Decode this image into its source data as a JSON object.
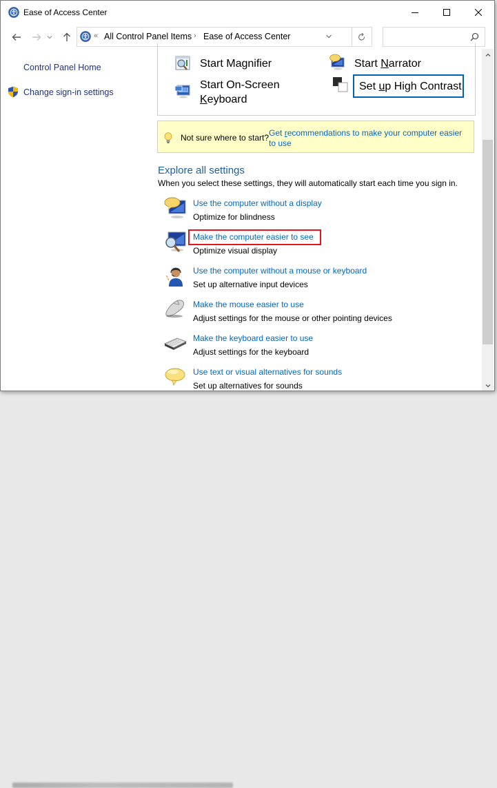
{
  "window": {
    "title": "Ease of Access Center",
    "controls": {
      "minimize": "minimize",
      "maximize": "maximize",
      "close": "close"
    }
  },
  "nav": {
    "back": "Back",
    "forward": "Forward",
    "recent": "Recent locations",
    "up": "Up",
    "overflow": "«",
    "breadcrumb": [
      "All Control Panel Items",
      "Ease of Access Center"
    ],
    "separator": "›",
    "search_placeholder": "",
    "search_value": ""
  },
  "sidebar": {
    "items": [
      {
        "label": "Control Panel Home",
        "icon": null
      },
      {
        "label": "Change sign-in settings",
        "icon": "shield-icon"
      }
    ]
  },
  "quick_access": {
    "items": [
      {
        "label": "Start Magnifier",
        "icon": "magnifier-icon"
      },
      {
        "label_pre": "Start ",
        "label_u": "N",
        "label_post": "arrator",
        "icon": "narrator-icon"
      },
      {
        "label_line1": "Start On-Screen",
        "label_u": "K",
        "label_post": "eyboard",
        "icon": "on-screen-keyboard-icon"
      },
      {
        "label_pre": "Set ",
        "label_u": "u",
        "label_post": "p High Contrast",
        "icon": "high-contrast-icon",
        "focused": true
      }
    ]
  },
  "tip": {
    "text": "Not sure where to start?",
    "link_pre": "Get ",
    "link_u": "r",
    "link_post": "ecommendations to make your computer easier to use"
  },
  "explore": {
    "title": "Explore all settings",
    "subtitle": "When you select these settings, they will automatically start each time you sign in.",
    "items": [
      {
        "link": "Use the computer without a display",
        "desc": "Optimize for blindness",
        "icon": "monitor-speech-icon"
      },
      {
        "link": "Make the computer easier to see",
        "desc": "Optimize visual display",
        "icon": "monitor-magnifier-icon",
        "highlighted": true
      },
      {
        "link": "Use the computer without a mouse or keyboard",
        "desc": "Set up alternative input devices",
        "icon": "person-headset-icon"
      },
      {
        "link": "Make the mouse easier to use",
        "desc": "Adjust settings for the mouse or other pointing devices",
        "icon": "mouse-icon"
      },
      {
        "link": "Make the keyboard easier to use",
        "desc": "Adjust settings for the keyboard",
        "icon": "keyboard-icon"
      },
      {
        "link": "Use text or visual alternatives for sounds",
        "desc": "Set up alternatives for sounds",
        "icon": "speech-bubble-icon"
      }
    ]
  },
  "colors": {
    "link": "#0066cc",
    "sidebar_link": "#1e3287",
    "heading": "#1e5fa3",
    "tip_bg": "#ffffc7",
    "focus": "#0063b1",
    "highlight": "#e8141a"
  }
}
